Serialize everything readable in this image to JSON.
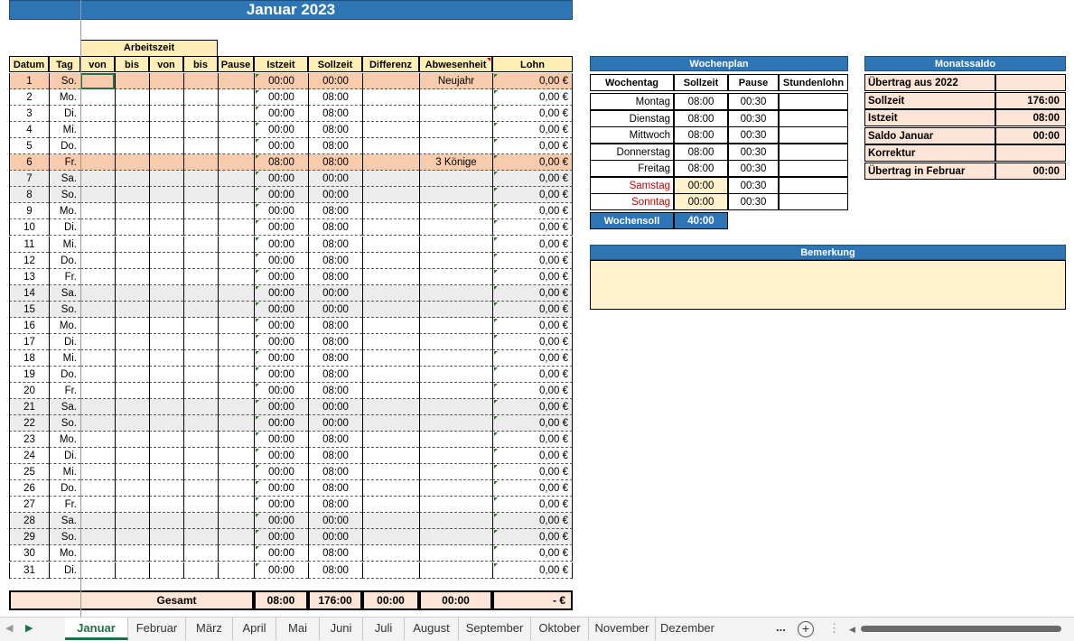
{
  "title": "Januar 2023",
  "arbeitszeit_label": "Arbeitszeit",
  "headers": [
    "Datum",
    "Tag",
    "von",
    "bis",
    "von",
    "bis",
    "Pause",
    "Istzeit",
    "Sollzeit",
    "Differenz",
    "Abwesenheit",
    "Lohn"
  ],
  "rows": [
    {
      "d": "1",
      "t": "So.",
      "ist": "00:00",
      "soll": "00:00",
      "abw": "Neujahr",
      "lohn": "0,00 €",
      "type": "holiday"
    },
    {
      "d": "2",
      "t": "Mo.",
      "ist": "00:00",
      "soll": "08:00",
      "abw": "",
      "lohn": "0,00 €",
      "type": "work"
    },
    {
      "d": "3",
      "t": "Di.",
      "ist": "00:00",
      "soll": "08:00",
      "abw": "",
      "lohn": "0,00 €",
      "type": "work"
    },
    {
      "d": "4",
      "t": "Mi.",
      "ist": "00:00",
      "soll": "08:00",
      "abw": "",
      "lohn": "0,00 €",
      "type": "work"
    },
    {
      "d": "5",
      "t": "Do.",
      "ist": "00:00",
      "soll": "08:00",
      "abw": "",
      "lohn": "0,00 €",
      "type": "work"
    },
    {
      "d": "6",
      "t": "Fr.",
      "ist": "08:00",
      "soll": "08:00",
      "abw": "3 Könige",
      "lohn": "0,00 €",
      "type": "holiday"
    },
    {
      "d": "7",
      "t": "Sa.",
      "ist": "00:00",
      "soll": "00:00",
      "abw": "",
      "lohn": "0,00 €",
      "type": "weekend"
    },
    {
      "d": "8",
      "t": "So.",
      "ist": "00:00",
      "soll": "00:00",
      "abw": "",
      "lohn": "0,00 €",
      "type": "weekend"
    },
    {
      "d": "9",
      "t": "Mo.",
      "ist": "00:00",
      "soll": "08:00",
      "abw": "",
      "lohn": "0,00 €",
      "type": "work"
    },
    {
      "d": "10",
      "t": "Di.",
      "ist": "00:00",
      "soll": "08:00",
      "abw": "",
      "lohn": "0,00 €",
      "type": "work"
    },
    {
      "d": "11",
      "t": "Mi.",
      "ist": "00:00",
      "soll": "08:00",
      "abw": "",
      "lohn": "0,00 €",
      "type": "work"
    },
    {
      "d": "12",
      "t": "Do.",
      "ist": "00:00",
      "soll": "08:00",
      "abw": "",
      "lohn": "0,00 €",
      "type": "work"
    },
    {
      "d": "13",
      "t": "Fr.",
      "ist": "00:00",
      "soll": "08:00",
      "abw": "",
      "lohn": "0,00 €",
      "type": "work"
    },
    {
      "d": "14",
      "t": "Sa.",
      "ist": "00:00",
      "soll": "00:00",
      "abw": "",
      "lohn": "0,00 €",
      "type": "weekend"
    },
    {
      "d": "15",
      "t": "So.",
      "ist": "00:00",
      "soll": "00:00",
      "abw": "",
      "lohn": "0,00 €",
      "type": "weekend"
    },
    {
      "d": "16",
      "t": "Mo.",
      "ist": "00:00",
      "soll": "08:00",
      "abw": "",
      "lohn": "0,00 €",
      "type": "work"
    },
    {
      "d": "17",
      "t": "Di.",
      "ist": "00:00",
      "soll": "08:00",
      "abw": "",
      "lohn": "0,00 €",
      "type": "work"
    },
    {
      "d": "18",
      "t": "Mi.",
      "ist": "00:00",
      "soll": "08:00",
      "abw": "",
      "lohn": "0,00 €",
      "type": "work"
    },
    {
      "d": "19",
      "t": "Do.",
      "ist": "00:00",
      "soll": "08:00",
      "abw": "",
      "lohn": "0,00 €",
      "type": "work"
    },
    {
      "d": "20",
      "t": "Fr.",
      "ist": "00:00",
      "soll": "08:00",
      "abw": "",
      "lohn": "0,00 €",
      "type": "work"
    },
    {
      "d": "21",
      "t": "Sa.",
      "ist": "00:00",
      "soll": "00:00",
      "abw": "",
      "lohn": "0,00 €",
      "type": "weekend"
    },
    {
      "d": "22",
      "t": "So.",
      "ist": "00:00",
      "soll": "00:00",
      "abw": "",
      "lohn": "0,00 €",
      "type": "weekend"
    },
    {
      "d": "23",
      "t": "Mo.",
      "ist": "00:00",
      "soll": "08:00",
      "abw": "",
      "lohn": "0,00 €",
      "type": "work"
    },
    {
      "d": "24",
      "t": "Di.",
      "ist": "00:00",
      "soll": "08:00",
      "abw": "",
      "lohn": "0,00 €",
      "type": "work"
    },
    {
      "d": "25",
      "t": "Mi.",
      "ist": "00:00",
      "soll": "08:00",
      "abw": "",
      "lohn": "0,00 €",
      "type": "work"
    },
    {
      "d": "26",
      "t": "Do.",
      "ist": "00:00",
      "soll": "08:00",
      "abw": "",
      "lohn": "0,00 €",
      "type": "work"
    },
    {
      "d": "27",
      "t": "Fr.",
      "ist": "00:00",
      "soll": "08:00",
      "abw": "",
      "lohn": "0,00 €",
      "type": "work"
    },
    {
      "d": "28",
      "t": "Sa.",
      "ist": "00:00",
      "soll": "00:00",
      "abw": "",
      "lohn": "0,00 €",
      "type": "weekend"
    },
    {
      "d": "29",
      "t": "So.",
      "ist": "00:00",
      "soll": "00:00",
      "abw": "",
      "lohn": "0,00 €",
      "type": "weekend"
    },
    {
      "d": "30",
      "t": "Mo.",
      "ist": "00:00",
      "soll": "08:00",
      "abw": "",
      "lohn": "0,00 €",
      "type": "work"
    },
    {
      "d": "31",
      "t": "Di.",
      "ist": "00:00",
      "soll": "08:00",
      "abw": "",
      "lohn": "0,00 €",
      "type": "work"
    }
  ],
  "gesamt": {
    "label": "Gesamt",
    "ist": "08:00",
    "soll": "176:00",
    "diff": "00:00",
    "abw": "00:00",
    "lohn": "-   €"
  },
  "wochenplan": {
    "title": "Wochenplan",
    "headers": [
      "Wochentag",
      "Sollzeit",
      "Pause",
      "Stundenlohn"
    ],
    "rows": [
      {
        "tag": "Montag",
        "soll": "08:00",
        "pause": "00:30",
        "lohn": "",
        "weekend": false
      },
      {
        "tag": "Dienstag",
        "soll": "08:00",
        "pause": "00:30",
        "lohn": "",
        "weekend": false
      },
      {
        "tag": "Mittwoch",
        "soll": "08:00",
        "pause": "00:30",
        "lohn": "",
        "weekend": false
      },
      {
        "tag": "Donnerstag",
        "soll": "08:00",
        "pause": "00:30",
        "lohn": "",
        "weekend": false
      },
      {
        "tag": "Freitag",
        "soll": "08:00",
        "pause": "00:30",
        "lohn": "",
        "weekend": false
      },
      {
        "tag": "Samstag",
        "soll": "00:00",
        "pause": "00:30",
        "lohn": "",
        "weekend": true
      },
      {
        "tag": "Sonntag",
        "soll": "00:00",
        "pause": "00:30",
        "lohn": "",
        "weekend": true
      }
    ],
    "soll_label": "Wochensoll",
    "soll_value": "40:00"
  },
  "monatssaldo": {
    "title": "Monatssaldo",
    "rows": [
      {
        "label": "Übertrag aus 2022",
        "value": ""
      },
      {
        "label": "Sollzeit",
        "value": "176:00"
      },
      {
        "label": "Istzeit",
        "value": "08:00"
      },
      {
        "label": "Saldo Januar",
        "value": "00:00"
      },
      {
        "label": "Korrektur",
        "value": ""
      },
      {
        "label": "Übertrag in Februar",
        "value": "00:00"
      }
    ]
  },
  "bemerkung": {
    "title": "Bemerkung"
  },
  "tabs": [
    "Januar",
    "Februar",
    "März",
    "April",
    "Mai",
    "Juni",
    "Juli",
    "August",
    "September",
    "Oktober",
    "November",
    "Dezember"
  ],
  "active_tab": "Januar",
  "tab_more": "...",
  "colors": {
    "blue": "#2e75b6",
    "header": "#ffeeb5",
    "holiday": "#f8cbad",
    "weekend": "#ececec",
    "saldo": "#fce4d6"
  }
}
